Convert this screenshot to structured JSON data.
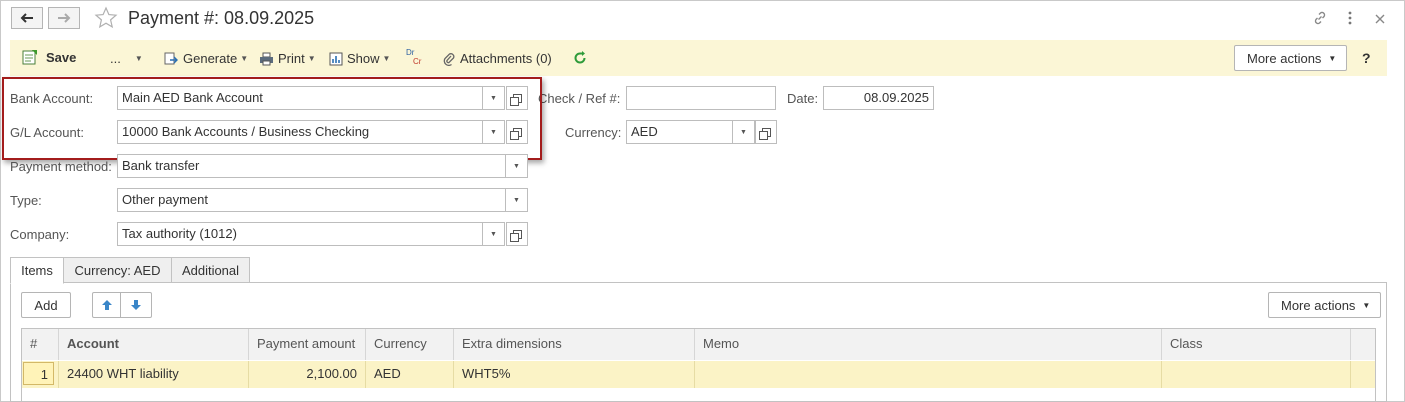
{
  "window": {
    "title": "Payment #:  08.09.2025"
  },
  "toolbar": {
    "save": "Save",
    "dots": "...",
    "generate": "Generate",
    "print": "Print",
    "show": "Show",
    "drcr_top": "Dr",
    "drcr_bottom": "Cr",
    "attachments": "Attachments (0)",
    "more_actions": "More actions",
    "help": "?"
  },
  "form": {
    "bank_account": {
      "label": "Bank Account:",
      "value": "Main AED Bank Account"
    },
    "gl_account": {
      "label": "G/L Account:",
      "value": "10000 Bank Accounts / Business Checking"
    },
    "check_ref": {
      "label": "Check / Ref #:",
      "value": ""
    },
    "date": {
      "label": "Date:",
      "value": "08.09.2025"
    },
    "currency": {
      "label": "Currency:",
      "value": "AED"
    },
    "payment_method": {
      "label": "Payment method:",
      "value": "Bank transfer"
    },
    "type": {
      "label": "Type:",
      "value": "Other payment"
    },
    "company": {
      "label": "Company:",
      "value": "Tax authority (1012)"
    }
  },
  "tabs": [
    "Items",
    "Currency: AED",
    "Additional"
  ],
  "items": {
    "add": "Add",
    "more_actions": "More actions",
    "columns": [
      "#",
      "Account",
      "Payment amount",
      "Currency",
      "Extra dimensions",
      "Memo",
      "Class"
    ],
    "rows": [
      {
        "num": "1",
        "account": "24400 WHT liability",
        "amount": "2,100.00",
        "currency": "AED",
        "extra": "WHT5%",
        "memo": "",
        "class": ""
      }
    ]
  }
}
